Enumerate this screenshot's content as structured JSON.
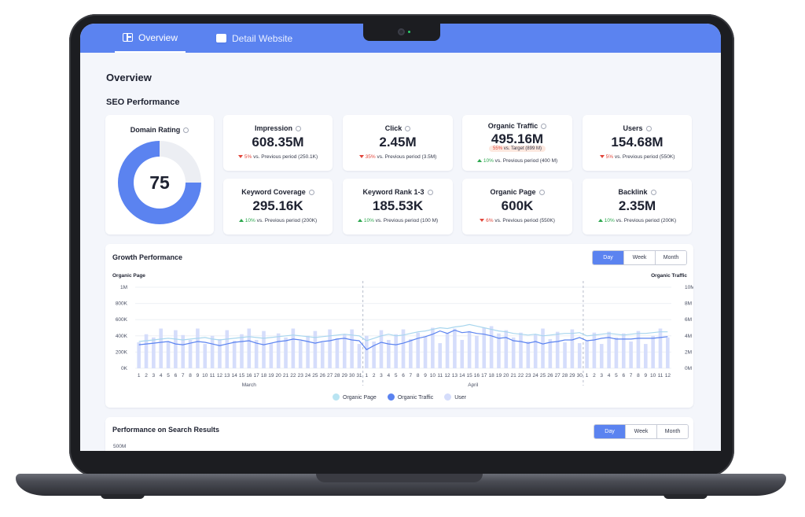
{
  "nav": {
    "tabs": [
      {
        "label": "Overview",
        "icon": "layout-icon",
        "active": true
      },
      {
        "label": "Detail Website",
        "icon": "card-icon",
        "active": false
      }
    ]
  },
  "page": {
    "title": "Overview",
    "section": "SEO Performance"
  },
  "colors": {
    "accent": "#5b83f0",
    "light": "#d5ddfb",
    "cyan": "#a8d6ee",
    "down": "#e2463b",
    "up": "#2ea84f"
  },
  "domain_rating": {
    "label": "Domain Rating",
    "value": "75",
    "fraction": 0.75
  },
  "metrics": [
    {
      "name": "Impression",
      "value": "608.35M",
      "pct": "5%",
      "dir": "down",
      "text": "vs. Previous period (250.1K)"
    },
    {
      "name": "Click",
      "value": "2.45M",
      "pct": "35%",
      "dir": "down",
      "text": "vs. Previous period (3.5M)"
    },
    {
      "name": "Organic Traffic",
      "value": "495.16M",
      "target_pct": "55%",
      "target_text": "vs. Target (899 M)",
      "pct": "10%",
      "dir": "up",
      "text": "vs. Previous period (400 M)"
    },
    {
      "name": "Users",
      "value": "154.68M",
      "pct": "5%",
      "dir": "down",
      "text": "vs. Previous period (550K)"
    },
    {
      "name": "Keyword Coverage",
      "value": "295.16K",
      "pct": "10%",
      "dir": "up",
      "text": "vs. Previous period (200K)"
    },
    {
      "name": "Keyword Rank 1-3",
      "value": "185.53K",
      "pct": "10%",
      "dir": "up",
      "text": "vs. Previous period (100 M)"
    },
    {
      "name": "Organic Page",
      "value": "600K",
      "pct": "6%",
      "dir": "down",
      "text": "vs. Previous period (550K)"
    },
    {
      "name": "Backlink",
      "value": "2.35M",
      "pct": "10%",
      "dir": "up",
      "text": "vs. Previous period (200K)"
    }
  ],
  "growth": {
    "title": "Growth Performance",
    "range_options": [
      "Day",
      "Week",
      "Month"
    ],
    "selected": "Day",
    "left_axis_title": "Organic Page",
    "right_axis_title": "Organic Traffic",
    "legend": [
      "Organic Page",
      "Organic Traffic",
      "User"
    ]
  },
  "search_results": {
    "title": "Performance on Search Results",
    "range_options": [
      "Day",
      "Week",
      "Month"
    ],
    "selected": "Day",
    "first_tick": "500M"
  },
  "chart_data": {
    "type": "bar",
    "title": "Growth Performance",
    "left_axis": {
      "label": "Organic Page",
      "ticks": [
        "0K",
        "200K",
        "400K",
        "600K",
        "800K",
        "1M"
      ],
      "range": [
        0,
        1000000
      ]
    },
    "right_axis": {
      "label": "Organic Traffic",
      "ticks": [
        "0M",
        "2M",
        "4M",
        "6M",
        "8M",
        "10M"
      ],
      "range": [
        0,
        10000000
      ]
    },
    "month_labels": [
      "March",
      "April"
    ],
    "categories": [
      "1",
      "2",
      "3",
      "4",
      "5",
      "6",
      "7",
      "8",
      "9",
      "10",
      "11",
      "12",
      "13",
      "14",
      "15",
      "16",
      "17",
      "18",
      "19",
      "20",
      "21",
      "22",
      "23",
      "24",
      "25",
      "26",
      "27",
      "28",
      "29",
      "30",
      "31",
      "1",
      "2",
      "3",
      "4",
      "5",
      "6",
      "7",
      "8",
      "9",
      "10",
      "11",
      "12",
      "13",
      "14",
      "15",
      "16",
      "17",
      "18",
      "19",
      "20",
      "21",
      "22",
      "23",
      "24",
      "25",
      "26",
      "27",
      "28",
      "29",
      "30",
      "1",
      "2",
      "3",
      "4",
      "5",
      "6",
      "7",
      "8",
      "9",
      "10",
      "11",
      "12"
    ],
    "series": [
      {
        "name": "User",
        "values": [
          320000,
          420000,
          380000,
          490000,
          330000,
          470000,
          410000,
          350000,
          490000,
          300000,
          400000,
          360000,
          470000,
          340000,
          420000,
          490000,
          350000,
          460000,
          310000,
          430000,
          380000,
          490000,
          340000,
          400000,
          460000,
          320000,
          480000,
          370000,
          420000,
          480000,
          300000,
          400000,
          330000,
          470000,
          350000,
          420000,
          480000,
          360000,
          440000,
          390000,
          500000,
          310000,
          430000,
          490000,
          350000,
          460000,
          400000,
          500000,
          520000,
          430000,
          470000,
          380000,
          440000,
          330000,
          420000,
          490000,
          360000,
          450000,
          320000,
          480000,
          310000,
          340000,
          440000,
          300000,
          450000,
          380000,
          430000,
          330000,
          460000,
          300000,
          400000,
          490000,
          380000
        ]
      },
      {
        "name": "Organic Traffic",
        "values": [
          2900000,
          3000000,
          3100000,
          3200000,
          3300000,
          3000000,
          2900000,
          3100000,
          3300000,
          3200000,
          3000000,
          2800000,
          3000000,
          3200000,
          3300000,
          3400000,
          3100000,
          2900000,
          3100000,
          3300000,
          3400000,
          3600000,
          3500000,
          3300000,
          3100000,
          3300000,
          3400000,
          3600000,
          3700000,
          3500000,
          3400000,
          2300000,
          2800000,
          3200000,
          3000000,
          2900000,
          3100000,
          3400000,
          3700000,
          3900000,
          4200000,
          4600000,
          4300000,
          4700000,
          4400000,
          4500000,
          4300000,
          4200000,
          4000000,
          3700000,
          3800000,
          3400000,
          3300000,
          3100000,
          3300000,
          3000000,
          3200000,
          3300000,
          3500000,
          3500000,
          3800000,
          3400000,
          3500000,
          3700000,
          3800000,
          3600000,
          3600000,
          3600000,
          3700000,
          3700000,
          3700000,
          3800000,
          3900000
        ]
      },
      {
        "name": "Organic Page",
        "values": [
          330000,
          340000,
          350000,
          360000,
          370000,
          360000,
          350000,
          360000,
          370000,
          380000,
          360000,
          350000,
          360000,
          370000,
          380000,
          390000,
          380000,
          370000,
          380000,
          390000,
          400000,
          410000,
          400000,
          390000,
          380000,
          390000,
          400000,
          410000,
          420000,
          410000,
          400000,
          340000,
          370000,
          400000,
          420000,
          400000,
          410000,
          430000,
          450000,
          460000,
          480000,
          500000,
          490000,
          510000,
          520000,
          540000,
          520000,
          500000,
          480000,
          460000,
          450000,
          430000,
          420000,
          410000,
          420000,
          400000,
          410000,
          420000,
          430000,
          430000,
          440000,
          400000,
          410000,
          420000,
          430000,
          420000,
          410000,
          420000,
          430000,
          430000,
          440000,
          450000,
          450000
        ]
      }
    ]
  }
}
